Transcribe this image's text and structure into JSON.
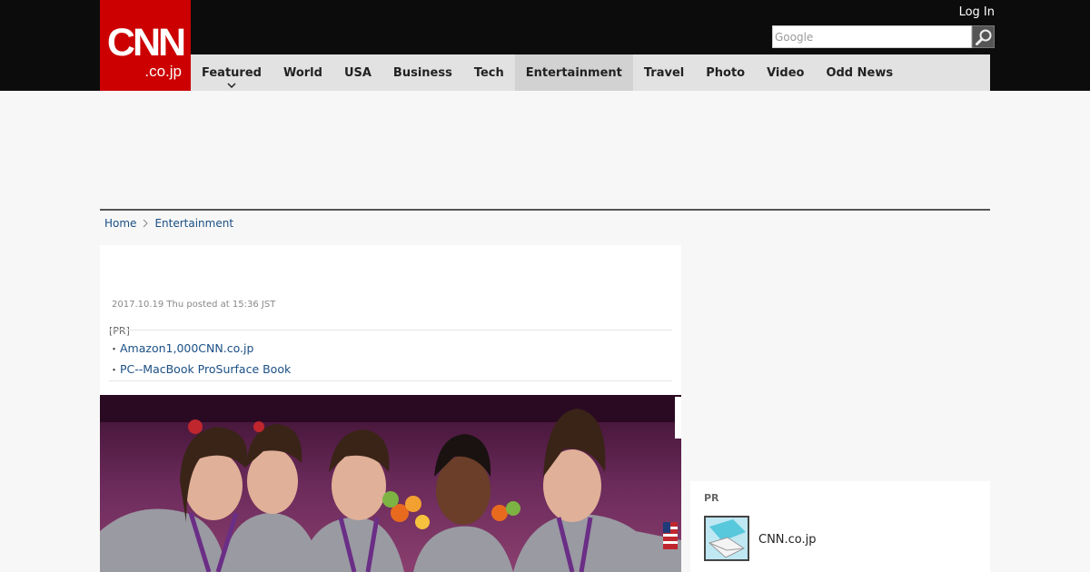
{
  "header": {
    "logo_main": "CNN",
    "logo_sub": ".co.jp",
    "login_label": "Log In",
    "search": {
      "placeholder": "Google",
      "value": "",
      "button_icon": "search-icon"
    }
  },
  "nav": {
    "items": [
      {
        "label": "Featured",
        "has_dropdown": true
      },
      {
        "label": "World"
      },
      {
        "label": "USA"
      },
      {
        "label": "Business"
      },
      {
        "label": "Tech"
      },
      {
        "label": "Entertainment",
        "active": true
      },
      {
        "label": "Travel"
      },
      {
        "label": "Photo"
      },
      {
        "label": "Video"
      },
      {
        "label": "Odd News"
      }
    ]
  },
  "breadcrumb": {
    "home": "Home",
    "current": "Entertainment"
  },
  "article": {
    "posted": "2017.10.19 Thu posted at 15:36 JST",
    "pr_label": "[PR]",
    "pr_links": [
      "Amazon1,000CNN.co.jp",
      "PC--MacBook ProSurface Book"
    ],
    "photo_icon": "gymnasts-photo"
  },
  "sidebar": {
    "pr_label": "PR",
    "pr_item_text": "CNN.co.jp",
    "pr_item_icon": "mail-thumbnail-icon"
  },
  "colors": {
    "topbar": "#0c0c0c",
    "logo_red": "#cc0000",
    "nav_bg": "#e2e2e2",
    "nav_active": "#d2d2d2",
    "link": "#1a4f84",
    "page_bg": "#f7f7f7"
  }
}
